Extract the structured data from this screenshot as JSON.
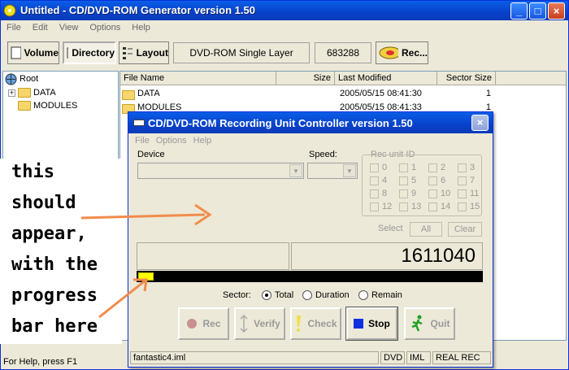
{
  "window": {
    "title": "Untitled - CD/DVD-ROM Generator version 1.50",
    "controls": [
      "_",
      "□",
      "×"
    ]
  },
  "menu": [
    "File",
    "Edit",
    "View",
    "Options",
    "Help"
  ],
  "toolbar": {
    "volume": "Volume",
    "directory": "Directory",
    "layout": "Layout",
    "media": "DVD-ROM Single Layer",
    "sectors": "683288",
    "rec": "Rec..."
  },
  "tree": {
    "root": "Root",
    "items": [
      "DATA",
      "MODULES"
    ]
  },
  "filelist": {
    "columns": [
      "File Name",
      "Size",
      "Last Modified",
      "Sector Size"
    ],
    "rows": [
      {
        "name": "DATA",
        "size": "",
        "modified": "2005/05/15 08:41:30",
        "sector": "1"
      },
      {
        "name": "MODULES",
        "size": "",
        "modified": "2005/05/15 08:41:33",
        "sector": "1"
      }
    ]
  },
  "statusbar": "For Help, press F1",
  "dialog": {
    "title": "CD/DVD-ROM Recording Unit Controller version 1.50",
    "close": "×",
    "menu": [
      "File",
      "Options",
      "Help"
    ],
    "device_label": "Device",
    "speed_label": "Speed:",
    "rec_unit_label": "Rec unit ID",
    "unit_ids": [
      "0",
      "1",
      "2",
      "3",
      "4",
      "5",
      "6",
      "7",
      "8",
      "9",
      "10",
      "11",
      "12",
      "13",
      "14",
      "15"
    ],
    "select_label": "Select",
    "all_label": "All",
    "clear_label": "Clear",
    "counter": "1611040",
    "progress_fraction": 0.045,
    "sector_label": "Sector:",
    "radios": [
      "Total",
      "Duration",
      "Remain"
    ],
    "selected_radio": "Total",
    "buttons": {
      "rec": "Rec",
      "verify": "Verify",
      "check": "Check",
      "stop": "Stop",
      "quit": "Quit"
    },
    "status": {
      "file": "fantastic4.iml",
      "media": "DVD",
      "format": "IML",
      "mode": "REAL REC"
    }
  },
  "annotation": {
    "lines": [
      "this",
      "should",
      "appear,",
      "with the",
      "progress",
      "bar here"
    ],
    "color": "#f28c4b"
  }
}
